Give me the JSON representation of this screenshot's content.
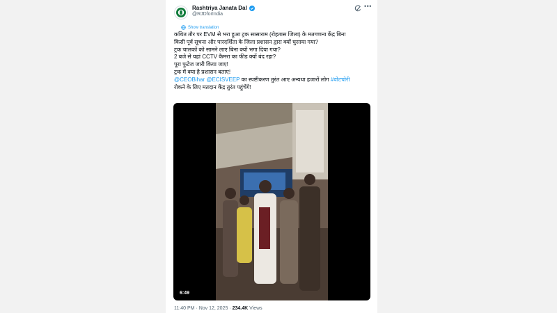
{
  "tweet": {
    "author_name": "Rashtriya Janata Dal",
    "handle": "@RJDforIndia",
    "show_translation": "Show translation",
    "lines": [
      "कथित तौर पर EVM से भरा हुआ ट्रक सासाराम (रोहतास जिला) के मतगणना केंद्र बिना",
      "किसी पूर्व सूचना और पारदर्शिता के जिला प्रशासन द्वारा क्यों घुसाया गया?",
      "ट्रक चालकों को सामने लाए बिना क्यों भगा दिया गया?",
      "2 बजे से यहां CCTV कैमरा का फीड क्यों बंद रहा?",
      "पूरा फुटेज जारी किया जाए!",
      "ट्रक में क्या है प्रशासन बताए!"
    ],
    "mention1": "@CEOBihar",
    "mention2": "@ECISVEEP",
    "line7_text": "का स्पष्टीकरण तुरंत आए अन्यथा हजारों लोग",
    "hashtag": "#वोटचोरी",
    "line8": "रोकने के लिए मतदान केंद्र तुरंत पहुंचेंगे!",
    "video_duration": "6:49",
    "time": "11:40 PM",
    "separator": "·",
    "date": "Nov 12, 2025",
    "views_count": "234.4K",
    "views_label": "Views"
  },
  "colors": {
    "link": "#1d9bf0",
    "muted": "#536471",
    "text": "#0f1419",
    "verified_badge": "#1d9bf0",
    "avatar_green": "#0f7a3a"
  },
  "icons": [
    "party-logo-icon",
    "verified-badge-icon",
    "grok-icon",
    "more-options-icon",
    "translate-icon"
  ]
}
